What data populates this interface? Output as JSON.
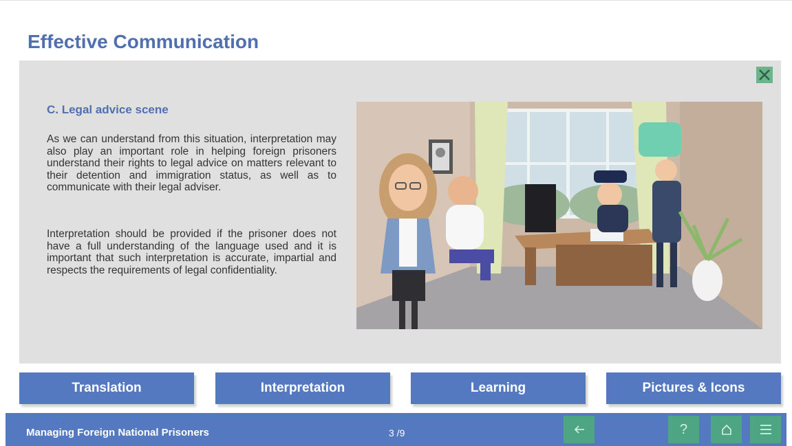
{
  "page": {
    "title": "Effective Communication"
  },
  "content": {
    "close_icon": "close-icon",
    "scene_title": "C. Legal advice scene",
    "paragraph_1": "As we can understand from this situation, interpretation may also play an important role in helping foreign prisoners understand their rights to legal advice on matters relevant to their detention and immigration status, as well as to communicate with their legal adviser.",
    "paragraph_2": "Interpretation should be provided if the prisoner does not have a full understanding of the language used and it is important that such interpretation is accurate, impartial and respects the requirements of legal confidentiality."
  },
  "nav": {
    "buttons": [
      {
        "label": "Translation"
      },
      {
        "label": "Interpretation"
      },
      {
        "label": "Learning"
      },
      {
        "label": "Pictures & Icons"
      }
    ]
  },
  "footer": {
    "course_title": "Managing Foreign National Prisoners",
    "page_indicator": "3 /9",
    "back_icon": "arrow-left-icon",
    "help_label": "?",
    "home_icon": "home-icon",
    "menu_icon": "hamburger-menu-icon"
  },
  "colors": {
    "accent": "#4f6fb0",
    "button": "#5579c0",
    "footer_button": "#4ea583",
    "panel": "#e0e0e0"
  }
}
